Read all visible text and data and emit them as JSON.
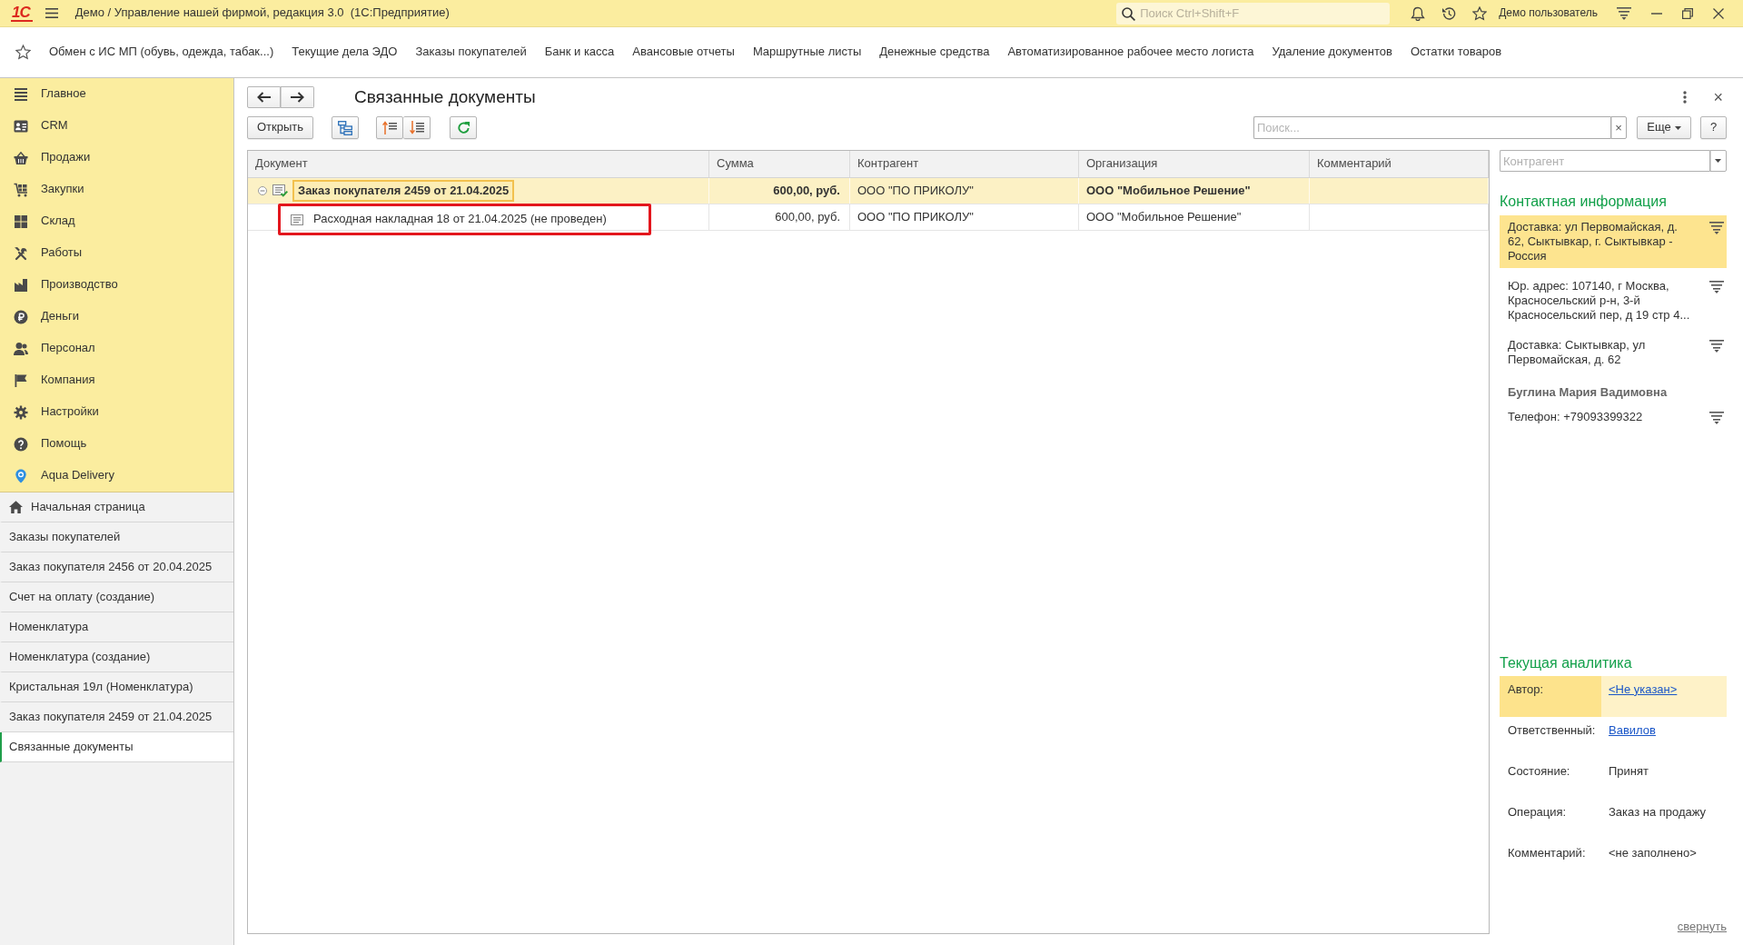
{
  "window": {
    "logo": "1С",
    "title": "Демо / Управление нашей фирмой, редакция 3.0  (1С:Предприятие)",
    "search": {
      "placeholder": "Поиск Ctrl+Shift+F"
    },
    "user": "Демо пользователь"
  },
  "favorites": [
    "Обмен с ИС МП (обувь, одежда, табак...)",
    "Текущие дела ЭДО",
    "Заказы покупателей",
    "Банк и касса",
    "Авансовые отчеты",
    "Маршрутные листы",
    "Денежные средства",
    "Автоматизированное рабочее место логиста",
    "Удаление документов",
    "Остатки товаров"
  ],
  "sections": [
    "Главное",
    "CRM",
    "Продажи",
    "Закупки",
    "Склад",
    "Работы",
    "Производство",
    "Деньги",
    "Персонал",
    "Компания",
    "Настройки",
    "Помощь",
    "Aqua Delivery"
  ],
  "open_windows": [
    {
      "kind": "home",
      "label": "Начальная страница",
      "selected": false
    },
    {
      "kind": "page",
      "label": "Заказы покупателей",
      "selected": false
    },
    {
      "kind": "page",
      "label": "Заказ покупателя 2456 от 20.04.2025",
      "selected": false
    },
    {
      "kind": "page",
      "label": "Счет на оплату (создание)",
      "selected": false
    },
    {
      "kind": "page",
      "label": "Номенклатура",
      "selected": false
    },
    {
      "kind": "page",
      "label": "Номенклатура (создание)",
      "selected": false
    },
    {
      "kind": "page",
      "label": "Кристальная 19л (Номенклатура)",
      "selected": false
    },
    {
      "kind": "page",
      "label": "Заказ покупателя 2459 от 21.04.2025",
      "selected": false
    },
    {
      "kind": "page",
      "label": "Связанные документы",
      "selected": true
    }
  ],
  "form": {
    "title": "Связанные документы",
    "close_button": "×",
    "toolbar": {
      "open_button": "Открыть",
      "search": {
        "placeholder": "Поиск...",
        "clear_button": "×"
      },
      "more_button": "Еще",
      "help_button": "?"
    },
    "table": {
      "columns": [
        "Документ",
        "Сумма",
        "Контрагент",
        "Организация",
        "Комментарий"
      ],
      "rows": [
        {
          "document": "Заказ покупателя 2459 от 21.04.2025",
          "sum": "600,00, руб.",
          "counterparty": "ООО \"ПО ПРИКОЛУ\"",
          "organization": "ООО \"Мобильное Решение\"",
          "selected": true,
          "current": true,
          "posted": true,
          "highlighted": false,
          "expanded": true,
          "children": [
            {
              "document": "Расходная накладная 18 от 21.04.2025 (не проведен)",
              "sum": "600,00, руб.",
              "counterparty": "ООО \"ПО ПРИКОЛУ\"",
              "organization": "ООО \"Мобильное Решение\"",
              "selected": false,
              "current": false,
              "posted": false,
              "highlighted": true
            }
          ]
        }
      ]
    }
  },
  "side_panel": {
    "counterparty_filter": {
      "placeholder": "Контрагент"
    },
    "contacts": {
      "title": "Контактная информация",
      "items": [
        {
          "kind": "address",
          "text": "Доставка: ул Первомайская, д. 62, Сыктывкар, г. Сыктывкар - Россия",
          "selected": true
        },
        {
          "kind": "address",
          "text": "Юр. адрес: 107140, г Москва, Красносельский р-н, 3-й Красносельский пер, д 19 стр 4...",
          "selected": false
        },
        {
          "kind": "address",
          "text": "Доставка: Сыктывкар, ул Первомайская, д. 62",
          "selected": false
        },
        {
          "kind": "person",
          "text": "Буглина Мария Вадимовна",
          "selected": false
        },
        {
          "kind": "phone",
          "text": "Телефон: +79093399322",
          "selected": false
        }
      ]
    },
    "analytics": {
      "title": "Текущая аналитика",
      "rows": [
        {
          "kind": "link",
          "label": "Автор:",
          "value": "<Не указан>",
          "selected": true
        },
        {
          "kind": "link",
          "label": "Ответственный:",
          "value": "Вавилов",
          "selected": false
        },
        {
          "kind": "text",
          "label": "Состояние:",
          "value": "Принят",
          "selected": false
        },
        {
          "kind": "text",
          "label": "Операция:",
          "value": "Заказ на продажу",
          "selected": false
        },
        {
          "kind": "text",
          "label": "Комментарий:",
          "value": "<не заполнено>",
          "selected": false
        }
      ]
    },
    "collapse_link": "свернуть"
  }
}
